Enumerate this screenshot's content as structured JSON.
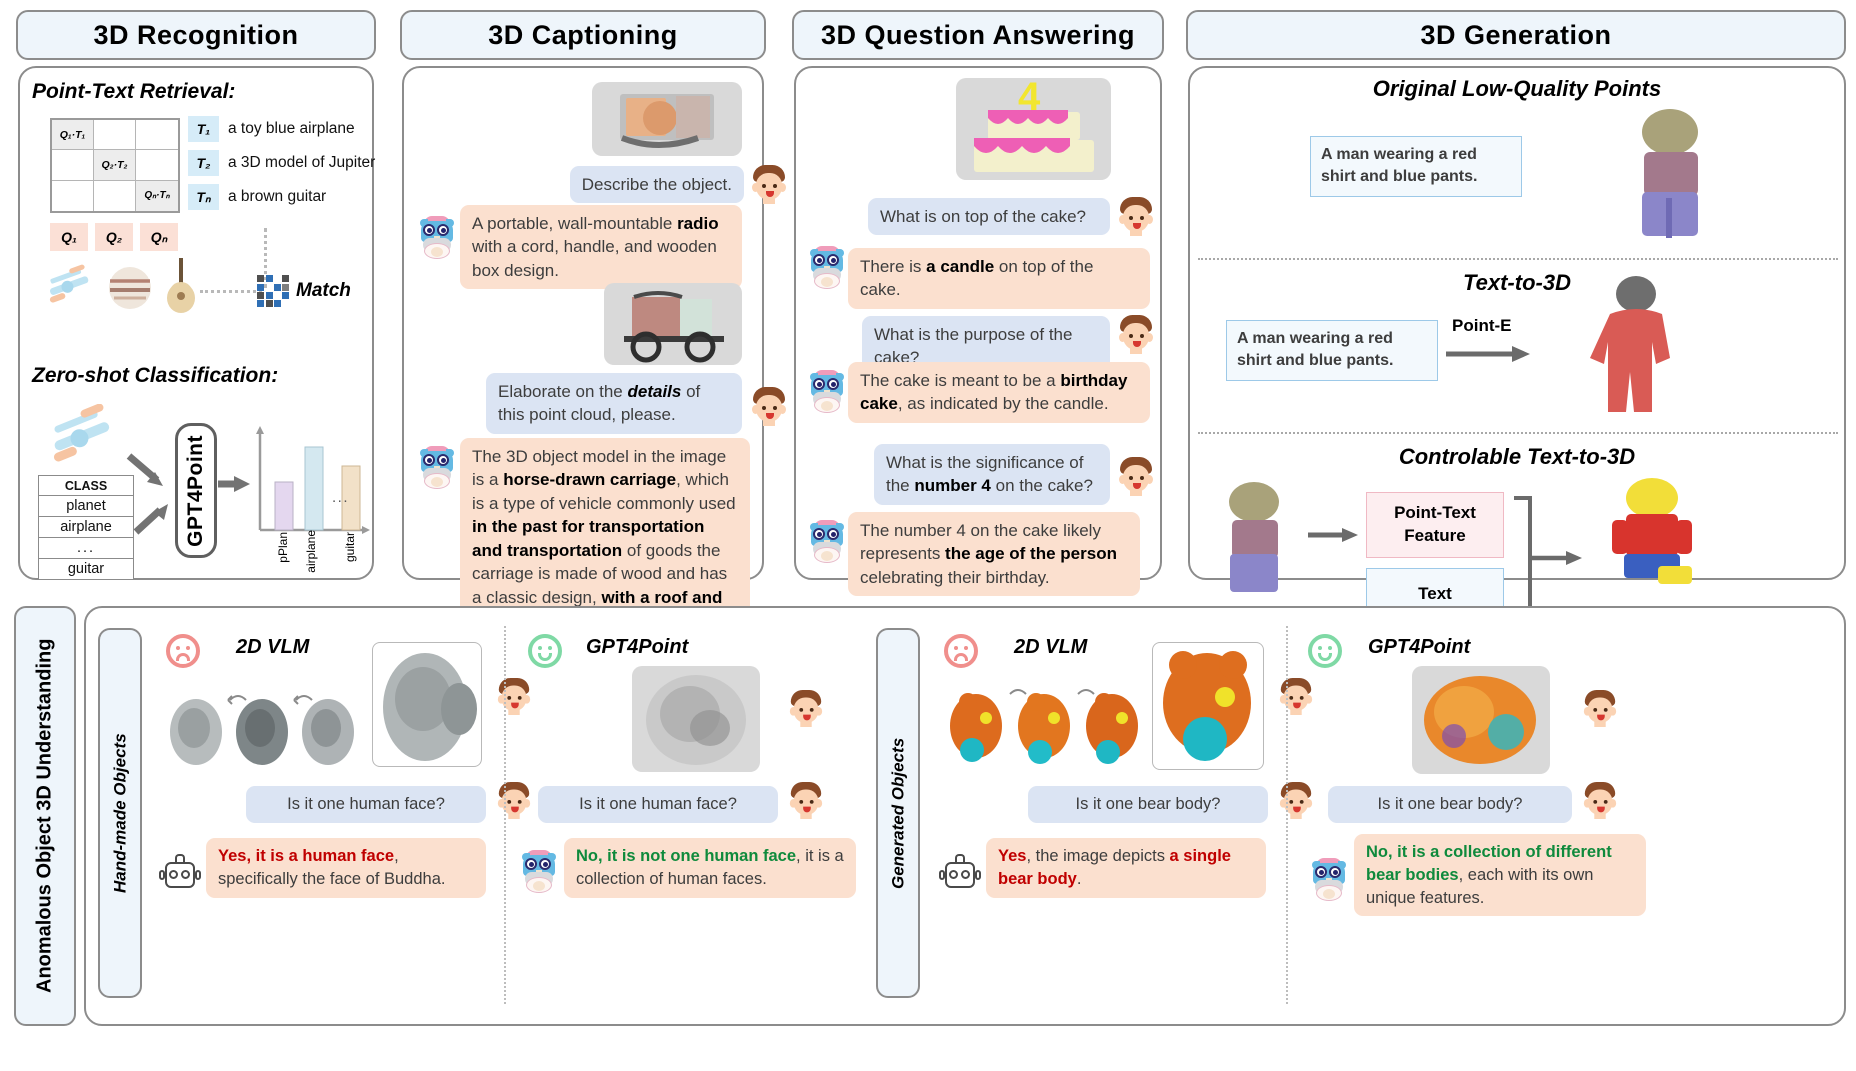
{
  "panels": {
    "recognition": {
      "title": "3D  Recognition",
      "retrieval_heading": "Point-Text Retrieval:",
      "matrix": {
        "diag_labels": [
          "Q₁·T₁",
          "Q₂·T₂",
          "Qₙ·Tₙ"
        ]
      },
      "text_keys": [
        "T₁",
        "T₂",
        "Tₙ"
      ],
      "text_values": [
        "a toy blue airplane",
        "a 3D model of Jupiter",
        "a brown guitar"
      ],
      "query_keys": [
        "Q₁",
        "Q₂",
        "Qₙ"
      ],
      "match_label": "Match",
      "zeroshot_heading": "Zero-shot Classification:",
      "model_label": "GPT4Point",
      "class_table": {
        "header": "CLASS",
        "rows": [
          "planet",
          "airplane",
          "...",
          "guitar"
        ]
      },
      "chart_axis_labels": [
        "pPlan",
        "airplane",
        "...",
        "guitar"
      ]
    },
    "captioning": {
      "title": "3D  Captioning",
      "turns": [
        {
          "role": "user",
          "text": "Describe the object."
        },
        {
          "role": "assistant",
          "html": "A portable, wall-mountable <b>radio</b> with a cord, handle, and wooden box design."
        },
        {
          "role": "user",
          "html": "Elaborate on the <b><i>details</i></b> of this point cloud, please."
        },
        {
          "role": "assistant",
          "html": "The 3D object model in the image is a <b>horse-drawn carriage</b>, which is a type of vehicle commonly used <b>in the past for transportation and transportation</b> of goods the carriage is made of wood and has a classic design, <b>with a roof and wooden wheels.</b>"
        }
      ]
    },
    "qa": {
      "title": "3D Question Answering",
      "cake_number": "4",
      "turns": [
        {
          "role": "user",
          "text": "What is on top of the cake?"
        },
        {
          "role": "assistant",
          "html": "There is <b>a candle</b> on top of the cake."
        },
        {
          "role": "user",
          "text": "What is the purpose of the cake?"
        },
        {
          "role": "assistant",
          "html": "The cake is meant to be a <b>birthday cake</b>, as indicated by the candle."
        },
        {
          "role": "user",
          "html": "What is the significance of the <b>number 4</b> on the cake?"
        },
        {
          "role": "assistant",
          "html": "The number 4 on the cake likely represents <b>the age of the person</b> celebrating their birthday."
        }
      ]
    },
    "generation": {
      "title": "3D  Generation",
      "sections": [
        {
          "heading": "Original Low-Quality Points",
          "prompt": "A man wearing a red shirt and blue pants."
        },
        {
          "heading": "Text-to-3D",
          "prompt": "A man wearing a red shirt and blue pants.",
          "arrow_label": "Point-E"
        },
        {
          "heading": "Controlable Text-to-3D",
          "feature_label": "Point-Text Feature",
          "text_label": "Text"
        }
      ]
    },
    "anomalous": {
      "side_label": "Anomalous Object 3D Understanding",
      "groups": [
        {
          "group_label": "Hand-made Objects",
          "cells": [
            {
              "model": "2D VLM",
              "mood": "sad",
              "question": "Is it one human face?",
              "answer_html": "<span class=\"red\">Yes, it is a human face</span>, specifically the face of Buddha.",
              "agent": "robot"
            },
            {
              "model": "GPT4Point",
              "mood": "happy",
              "question": "Is it one human face?",
              "answer_html": "<span class=\"green\">No, it is not one human face</span>, it is a collection of human faces.",
              "agent": "owl"
            }
          ]
        },
        {
          "group_label": "Generated Objects",
          "cells": [
            {
              "model": "2D VLM",
              "mood": "sad",
              "question": "Is it one bear body?",
              "answer_html": "<span class=\"red\">Yes</span>, the image depicts <span class=\"red\">a single bear body</span>.",
              "agent": "robot"
            },
            {
              "model": "GPT4Point",
              "mood": "happy",
              "question": "Is it one bear body?",
              "answer_html": "<span class=\"green\">No, it is a collection of different bear bodies</span>, each with its own unique features.",
              "agent": "owl"
            }
          ]
        }
      ]
    }
  },
  "chart_data": {
    "type": "bar",
    "title": "Zero-shot Classification scores",
    "categories": [
      "pPlan",
      "airplane",
      "...",
      "guitar"
    ],
    "values": [
      48,
      100,
      0,
      72
    ],
    "ylim": [
      0,
      110
    ],
    "xlabel": "",
    "ylabel": "",
    "grid": false,
    "legend": "none",
    "bar_colors": [
      "#e4d7ef",
      "#d4e8f0",
      "transparent",
      "#f2e1c8"
    ]
  },
  "colors": {
    "title_bg": "#eef5fb",
    "border": "#8c8c8c",
    "question_bubble": "#dbe4f3",
    "answer_bubble": "#fbe0cf",
    "query_chip": "#fbe0d6",
    "text_chip": "#d6ecf8",
    "red": "#c00000",
    "green": "#0f8a3c"
  }
}
